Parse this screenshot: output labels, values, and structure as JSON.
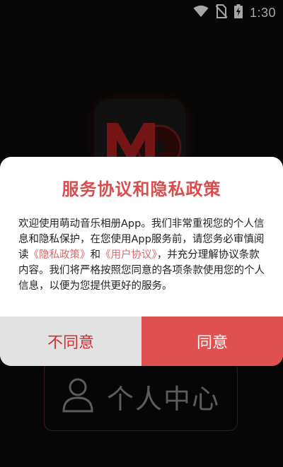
{
  "status_bar": {
    "time": "1:30",
    "icons": [
      "wifi-icon",
      "no-sim-icon",
      "battery-charging-icon"
    ]
  },
  "background": {
    "logo_text": "M",
    "personal_center_label": "个人中心",
    "personal_center_icon": "person-icon"
  },
  "dialog": {
    "title": "服务协议和隐私政策",
    "body_part1": "欢迎使用萌动音乐相册App。我们非常重视您的个人信息和隐私保护，在您使用App服务前，请您务必审慎阅读",
    "privacy_link": "《隐私政策》",
    "and_text": "和",
    "user_agreement_link": "《用户协议》",
    "body_part2": "，并充分理解协议条款内容。我们将严格按照您同意的各项条款使用您的个人信息，以便为您提供更好的服务。",
    "disagree_label": "不同意",
    "agree_label": "同意"
  },
  "colors": {
    "accent": "#df5151",
    "title": "#d94d4d",
    "link": "#e06767",
    "disagree_bg": "#e2e2e2",
    "disagree_text": "#cf3030"
  }
}
